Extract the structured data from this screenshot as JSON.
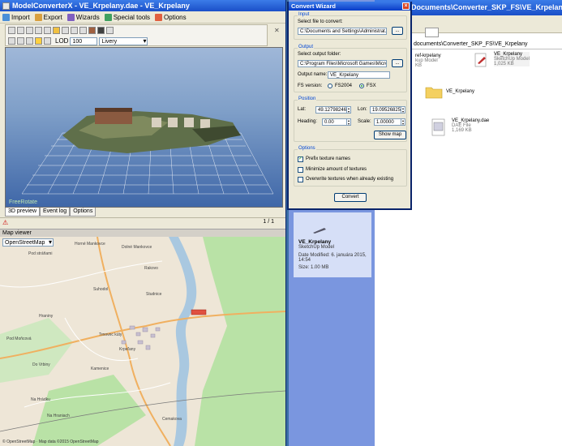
{
  "main_window": {
    "title": "ModelConverterX - VE_Krpelany.dae - VE_Krpelany",
    "menu": [
      {
        "label": "Import",
        "icon": "import-icon"
      },
      {
        "label": "Export",
        "icon": "export-icon"
      },
      {
        "label": "Wizards",
        "icon": "wizard-icon"
      },
      {
        "label": "Special tools",
        "icon": "tools-icon"
      },
      {
        "label": "Options",
        "icon": "options-icon"
      }
    ],
    "toolbar": {
      "lod_label": "LOD",
      "lod_value": "100",
      "livery_value": "Livery"
    },
    "preview": {
      "mode_label": "FreeRotate"
    },
    "tabs": [
      "3D preview",
      "Event log",
      "Options"
    ],
    "status": {
      "page": "1 / 1"
    }
  },
  "map_viewer": {
    "title": "Map viewer",
    "provider": "OpenStreetMap",
    "attribution": "© OpenStreetMap · Map data ©2015 OpenStreetMap",
    "labels": [
      "Horné Mankovce",
      "Pod stráňami",
      "Suhodol",
      "Hraniny",
      "Pod Moňcová",
      "Trnovec kúty",
      "Krpeľany",
      "Do Vrbiny",
      "Kamenice",
      "Na Hrádku",
      "Na Hraniach",
      "Rakovo",
      "Studnice",
      "Cemakova",
      "Dolné Mankovce"
    ]
  },
  "explorer": {
    "title": "Documents\\Converter_SKP_FS\\VE_Krpelany",
    "address": "documents\\Converter_SKP_FS\\VE_Krpelany",
    "files": [
      {
        "name": "ref-krpelany",
        "type": "kup Model",
        "size": "KB"
      },
      {
        "name": "VE_Krpelany",
        "type": "SketchUp Model",
        "size": "1,025 KB"
      },
      {
        "name": "VE_Krpelany",
        "type": "",
        "size": ""
      },
      {
        "name": "VE_Krpelany.dae",
        "type": "DAE File",
        "size": "1,169 KB"
      }
    ],
    "details": {
      "name": "VE_Krpelany",
      "type": "SketchUp Model",
      "date": "Date Modified: 6. januára 2015, 14:54",
      "size": "Size: 1.00 MB"
    }
  },
  "wizard": {
    "title": "Convert Wizard",
    "input": {
      "group": "Input",
      "label": "Select file to convert:",
      "value": "C:\\Documents and Settings\\Administrat...",
      "browse": "..."
    },
    "output": {
      "group": "Output",
      "folder_label": "Select output folder:",
      "folder_value": "C:\\Program Files\\Microsoft Games\\Microsof",
      "browse": "...",
      "name_label": "Output name:",
      "name_value": "VE_Krpelany",
      "fs_label": "FS version:",
      "fs_options": [
        "FS2004",
        "FSX"
      ],
      "fs_selected": "FSX"
    },
    "position": {
      "group": "Position",
      "lat_label": "Lat:",
      "lat_value": "49.12798246",
      "lon_label": "Lon:",
      "lon_value": "19.09526825",
      "heading_label": "Heading:",
      "heading_value": "0.00",
      "scale_label": "Scale:",
      "scale_value": "1.00000",
      "show_map": "Show map"
    },
    "options": {
      "group": "Options",
      "items": [
        {
          "label": "Prefix texture names",
          "checked": true
        },
        {
          "label": "Minimize amount of textures",
          "checked": false
        },
        {
          "label": "Overwrite textures when already existing",
          "checked": false
        }
      ]
    },
    "convert": "Convert"
  },
  "colors": {
    "xp_blue": "#1a4fc8",
    "grid": "#ffffff",
    "river": "#a9c8e0",
    "forest": "#b7e0a8",
    "road": "#f0b060",
    "marker": "#e05040"
  }
}
